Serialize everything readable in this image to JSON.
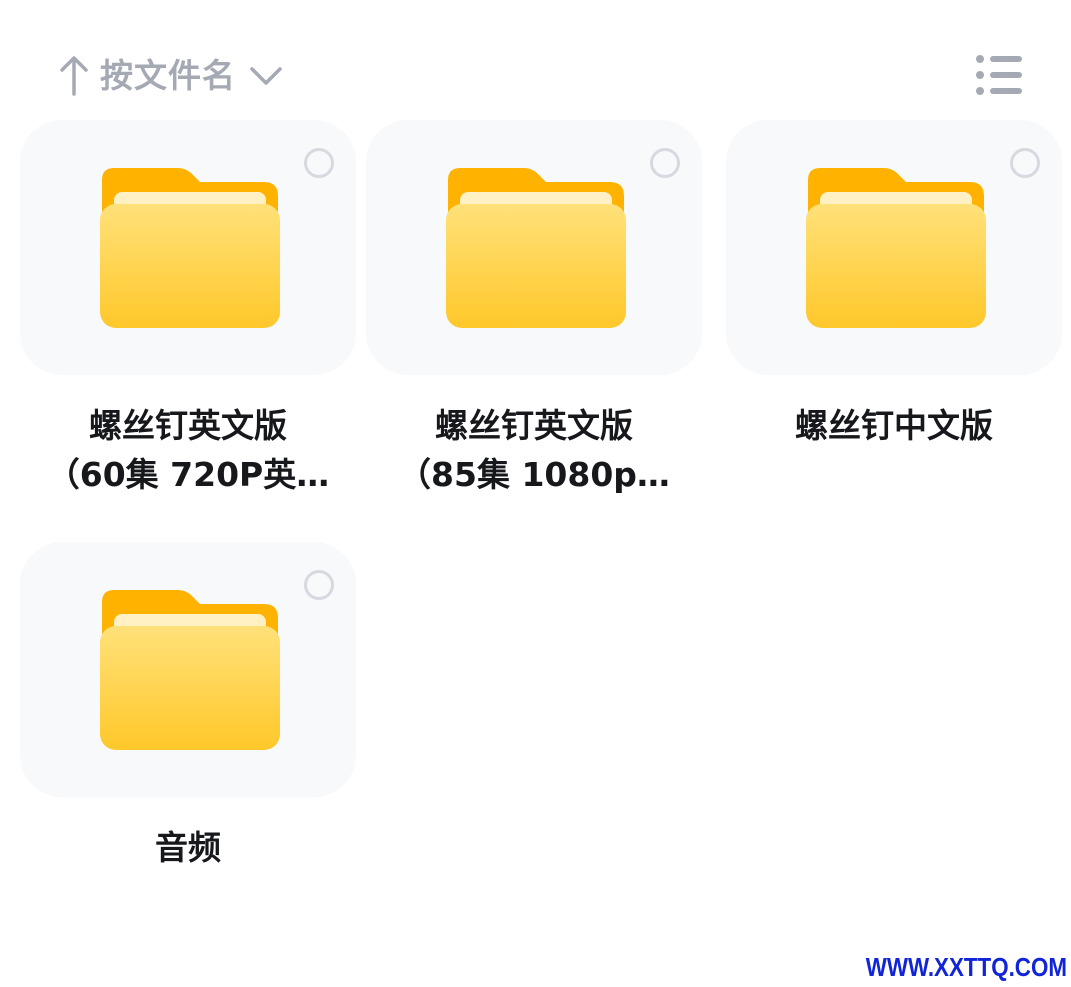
{
  "toolbar": {
    "sort_label": "按文件名",
    "sort_direction_icon": "arrow-up-icon",
    "sort_dropdown_icon": "chevron-down-icon",
    "view_toggle_icon": "list-view-icon"
  },
  "folders": [
    {
      "name": "螺丝钉英文版\n（60集 720P英…",
      "icon": "folder-icon",
      "selected": false
    },
    {
      "name": "螺丝钉英文版\n（85集 1080p…",
      "icon": "folder-icon",
      "selected": false
    },
    {
      "name": "螺丝钉中文版",
      "icon": "folder-icon",
      "selected": false
    },
    {
      "name": "音频",
      "icon": "folder-icon",
      "selected": false
    }
  ],
  "watermark": "WWW.XXTTQ.COM",
  "colors": {
    "tile_background": "#f8f9fb",
    "folder_yellow": "#ffd23f",
    "folder_tab": "#ffb300",
    "muted_gray": "#a4a9b4",
    "text": "#16181c",
    "watermark": "#1024d8"
  }
}
